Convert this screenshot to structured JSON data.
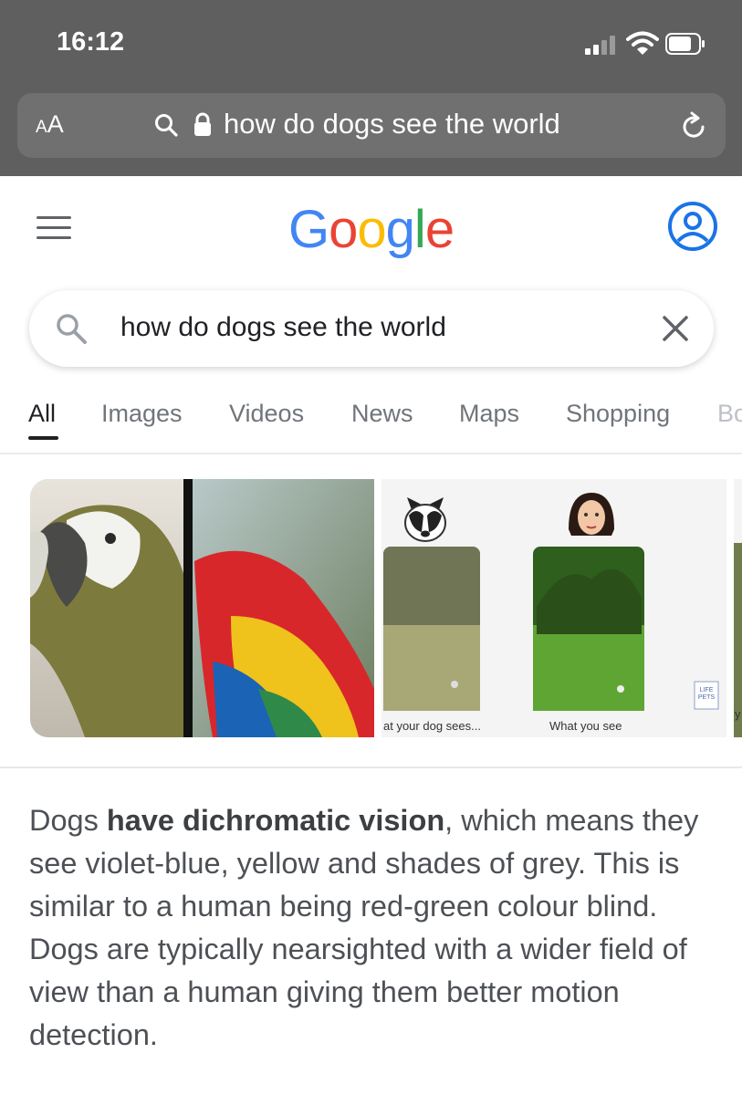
{
  "status_bar": {
    "time": "16:12"
  },
  "browser": {
    "text_size_label_small": "A",
    "text_size_label_large": "A",
    "url_text": "how do dogs see the world"
  },
  "header": {
    "logo_letters": [
      {
        "char": "G",
        "color": "#4285F4"
      },
      {
        "char": "o",
        "color": "#EA4335"
      },
      {
        "char": "o",
        "color": "#FBBC05"
      },
      {
        "char": "g",
        "color": "#4285F4"
      },
      {
        "char": "l",
        "color": "#34A853"
      },
      {
        "char": "e",
        "color": "#EA4335"
      }
    ],
    "accent_color": "#1a73e8"
  },
  "search": {
    "query": "how do dogs see the world"
  },
  "tabs": [
    {
      "label": "All",
      "active": true
    },
    {
      "label": "Images",
      "active": false
    },
    {
      "label": "Videos",
      "active": false
    },
    {
      "label": "News",
      "active": false
    },
    {
      "label": "Maps",
      "active": false
    },
    {
      "label": "Shopping",
      "active": false
    },
    {
      "label": "Bo",
      "active": false
    }
  ],
  "images": {
    "captions": [
      "at your dog sees...",
      "What you see"
    ],
    "watermark": "LIFE PETS",
    "third_caption": "y"
  },
  "snippet": {
    "before_bold": "Dogs ",
    "bold": "have dichromatic vision",
    "after_bold": ", which means they see violet-blue, yellow and shades of grey. This is similar to a human being red-green colour blind. Dogs are typically nearsighted with a wider field of view than a human giving them better motion detection."
  }
}
